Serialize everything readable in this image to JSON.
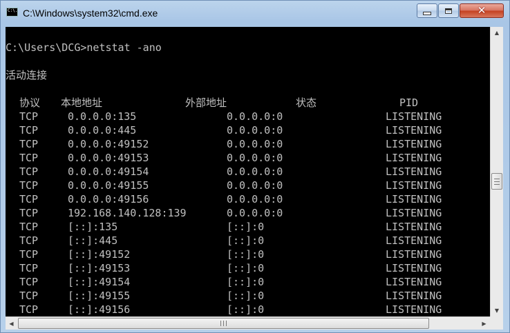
{
  "window": {
    "title": "C:\\Windows\\system32\\cmd.exe",
    "icon_text": "C:\\."
  },
  "console": {
    "prompt": "C:\\Users\\DCG>netstat -ano",
    "section_title": "活动连接",
    "headers": [
      "协议",
      "本地地址",
      "外部地址",
      "状态",
      "PID"
    ],
    "rows": [
      [
        "TCP",
        "0.0.0.0:135",
        "0.0.0.0:0",
        "LISTENING"
      ],
      [
        "TCP",
        "0.0.0.0:445",
        "0.0.0.0:0",
        "LISTENING"
      ],
      [
        "TCP",
        "0.0.0.0:49152",
        "0.0.0.0:0",
        "LISTENING"
      ],
      [
        "TCP",
        "0.0.0.0:49153",
        "0.0.0.0:0",
        "LISTENING"
      ],
      [
        "TCP",
        "0.0.0.0:49154",
        "0.0.0.0:0",
        "LISTENING"
      ],
      [
        "TCP",
        "0.0.0.0:49155",
        "0.0.0.0:0",
        "LISTENING"
      ],
      [
        "TCP",
        "0.0.0.0:49156",
        "0.0.0.0:0",
        "LISTENING"
      ],
      [
        "TCP",
        "192.168.140.128:139",
        "0.0.0.0:0",
        "LISTENING"
      ],
      [
        "TCP",
        "[::]:135",
        "[::]:0",
        "LISTENING"
      ],
      [
        "TCP",
        "[::]:445",
        "[::]:0",
        "LISTENING"
      ],
      [
        "TCP",
        "[::]:49152",
        "[::]:0",
        "LISTENING"
      ],
      [
        "TCP",
        "[::]:49153",
        "[::]:0",
        "LISTENING"
      ],
      [
        "TCP",
        "[::]:49154",
        "[::]:0",
        "LISTENING"
      ],
      [
        "TCP",
        "[::]:49155",
        "[::]:0",
        "LISTENING"
      ],
      [
        "TCP",
        "[::]:49156",
        "[::]:0",
        "LISTENING"
      ]
    ]
  },
  "colors": {
    "console_background": "#000000",
    "console_text": "#c0c0c0",
    "close_button": "#c4401f"
  },
  "icons": {
    "minimize": "minimize-icon",
    "maximize": "maximize-icon",
    "close": "close-icon"
  }
}
